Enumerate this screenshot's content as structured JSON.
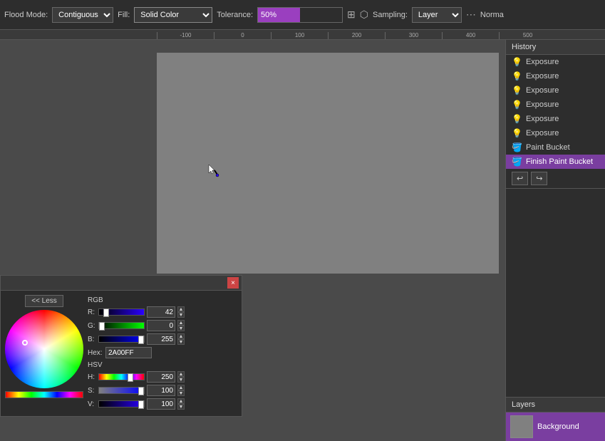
{
  "toolbar": {
    "flood_mode_label": "Flood Mode:",
    "fill_label": "Fill:",
    "fill_value": "Solid Color",
    "tolerance_label": "Tolerance:",
    "tolerance_value": "50%",
    "sampling_label": "Sampling:",
    "sampling_value": "Layer",
    "normal_label": "Norma"
  },
  "ruler": {
    "marks": [
      "-100",
      "0",
      "100",
      "200",
      "300",
      "400",
      "500"
    ]
  },
  "history": {
    "title": "History",
    "items": [
      {
        "label": "Exposure",
        "icon": "💡",
        "active": false
      },
      {
        "label": "Exposure",
        "icon": "💡",
        "active": false
      },
      {
        "label": "Exposure",
        "icon": "💡",
        "active": false
      },
      {
        "label": "Exposure",
        "icon": "💡",
        "active": false
      },
      {
        "label": "Exposure",
        "icon": "💡",
        "active": false
      },
      {
        "label": "Exposure",
        "icon": "💡",
        "active": false
      },
      {
        "label": "Paint Bucket",
        "icon": "🪣",
        "active": false
      },
      {
        "label": "Finish Paint Bucket",
        "icon": "🪣",
        "active": true
      }
    ],
    "undo_label": "↩",
    "redo_label": "↪"
  },
  "layers": {
    "title": "Layers",
    "items": [
      {
        "name": "Background",
        "thumb_color": "#808080"
      }
    ]
  },
  "color_picker": {
    "close_label": "×",
    "less_label": "<< Less",
    "section_rgb": "RGB",
    "r_label": "R:",
    "r_value": "42",
    "g_label": "G:",
    "g_value": "0",
    "b_label": "B:",
    "b_value": "255",
    "hex_label": "Hex:",
    "hex_value": "2A00FF",
    "section_hsv": "HSV",
    "h_label": "H:",
    "h_value": "250",
    "s_label": "S:",
    "s_value": "100",
    "v_label": "V:",
    "v_value": "100"
  }
}
